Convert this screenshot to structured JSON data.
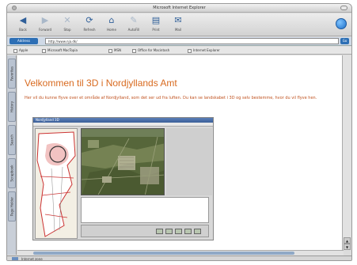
{
  "window": {
    "title": "Microsoft Internet Explorer"
  },
  "toolbar": {
    "buttons": [
      {
        "label": "Back",
        "icon": "back-arrow-icon",
        "glyph": "◀",
        "enabled": true
      },
      {
        "label": "Forward",
        "icon": "forward-arrow-icon",
        "glyph": "▶",
        "enabled": false
      },
      {
        "label": "Stop",
        "icon": "stop-icon",
        "glyph": "✕",
        "enabled": false
      },
      {
        "label": "Refresh",
        "icon": "refresh-icon",
        "glyph": "⟳",
        "enabled": true
      },
      {
        "label": "Home",
        "icon": "home-icon",
        "glyph": "⌂",
        "enabled": true
      },
      {
        "label": "AutoFill",
        "icon": "autofill-icon",
        "glyph": "✎",
        "enabled": false
      },
      {
        "label": "Print",
        "icon": "print-icon",
        "glyph": "▤",
        "enabled": true
      },
      {
        "label": "Mail",
        "icon": "mail-icon",
        "glyph": "✉",
        "enabled": true
      }
    ]
  },
  "address": {
    "label": "Address",
    "value": "http://www.nja.dk/",
    "go_label": "Go"
  },
  "favorites": [
    "Apple",
    "Microsoft MacTopia",
    "MSN",
    "Office for Macintosh",
    "Internet Explorer"
  ],
  "sidetabs": [
    "Favorites",
    "History",
    "Search",
    "Scrapbook",
    "Page Holder"
  ],
  "page": {
    "title": "Velkommen til 3D i Nordjyllands Amt",
    "intro": "Her vil du kunne flyve over et område af Nordjylland, som det ser ud fra luften. Du kan se landskabet i 3D og selv bestemme, hvor du vil flyve hen."
  },
  "embedded_app": {
    "title": "Nordjylland 3D"
  },
  "status": {
    "text": "Internet zone"
  },
  "colors": {
    "title_orange": "#d86a1f",
    "text_orange": "#c0521f",
    "accent_blue": "#2d6fb5"
  }
}
